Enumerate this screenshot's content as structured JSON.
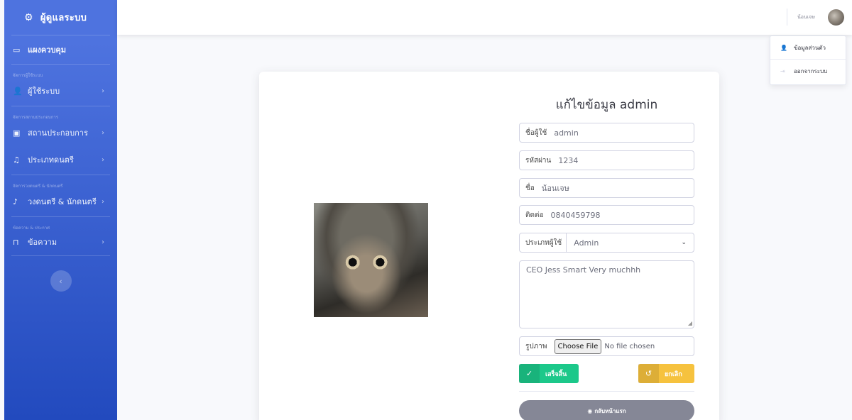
{
  "sidebar": {
    "brand": "ผู้ดูแลระบบ",
    "dashboard": "แผงควบคุม",
    "sections": [
      {
        "heading": "จัดการผู้ใช้ระบบ",
        "items": [
          {
            "label": "ผู้ใช้ระบบ"
          }
        ]
      },
      {
        "heading": "จัดการสถานประกอบการ",
        "items": [
          {
            "label": "สถานประกอบการ"
          },
          {
            "label": "ประเภทดนตรี"
          }
        ]
      },
      {
        "heading": "จัดการวงดนตรี & นักดนตรี",
        "items": [
          {
            "label": "วงดนตรี & นักดนตรี"
          }
        ]
      },
      {
        "heading": "ข้อความ & ประกาศ",
        "items": [
          {
            "label": "ข้อความ"
          }
        ]
      }
    ],
    "toggle_icon": "chevron-left"
  },
  "topbar": {
    "username": "น้อนเจษ"
  },
  "dropdown": {
    "items": [
      {
        "label": "ข้อมูลส่วนตัว",
        "icon": "user"
      },
      {
        "label": "ออกจากระบบ",
        "icon": "sign-out"
      }
    ]
  },
  "form": {
    "title": "แก้ไขข้อมูล admin",
    "username": {
      "label": "ชื่อผู้ใช้",
      "value": "admin"
    },
    "password": {
      "label": "รหัสผ่าน",
      "value": "1234"
    },
    "name": {
      "label": "ชื่อ",
      "value": "น้อนเจษ"
    },
    "contact": {
      "label": "ติดต่อ",
      "value": "0840459798"
    },
    "user_type": {
      "label": "ประเภทผู้ใช้",
      "value": "Admin"
    },
    "bio": "CEO Jess Smart Very muchhh",
    "image": {
      "label": "รูปภาพ",
      "button": "Choose File",
      "status": "No file chosen"
    },
    "save_label": "เสร็จสิ้น",
    "cancel_label": "ยกเลิก",
    "home_label": "กลับหน้าแรก"
  },
  "colors": {
    "sidebar_top": "#4e73df",
    "sidebar_bottom": "#224abe",
    "success": "#1cc88a",
    "warning": "#f6c23e",
    "secondary": "#858796"
  }
}
